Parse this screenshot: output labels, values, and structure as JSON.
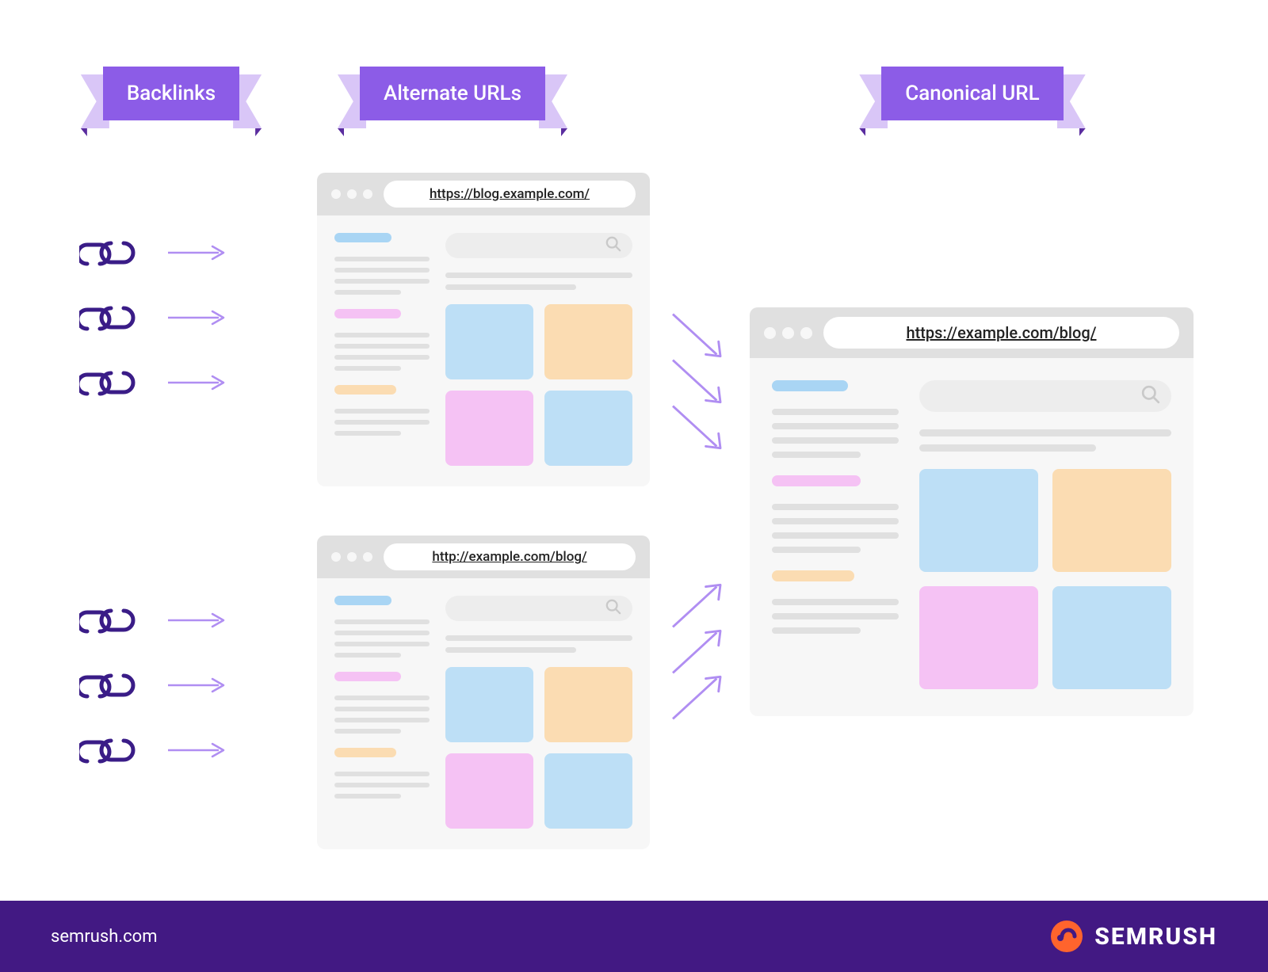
{
  "ribbons": {
    "backlinks": "Backlinks",
    "alternate": "Alternate URLs",
    "canonical": "Canonical URL"
  },
  "urls": {
    "alt1": "https://blog.example.com/",
    "alt2": "http://example.com/blog/",
    "canonical": "https://example.com/blog/"
  },
  "footer": {
    "site": "semrush.com",
    "brand": "SEMRUSH"
  },
  "colors": {
    "purple": "#8c5ce7",
    "purple_light": "#d9c6f7",
    "purple_dark": "#5a2d9f",
    "link_dark": "#3a1c87",
    "arrow": "#b08ef2",
    "footer": "#421983",
    "semrush_orange": "#ff642d",
    "tile_blue": "#bddff6",
    "tile_orange": "#fbdcb2",
    "tile_pink": "#f5c2f4"
  }
}
